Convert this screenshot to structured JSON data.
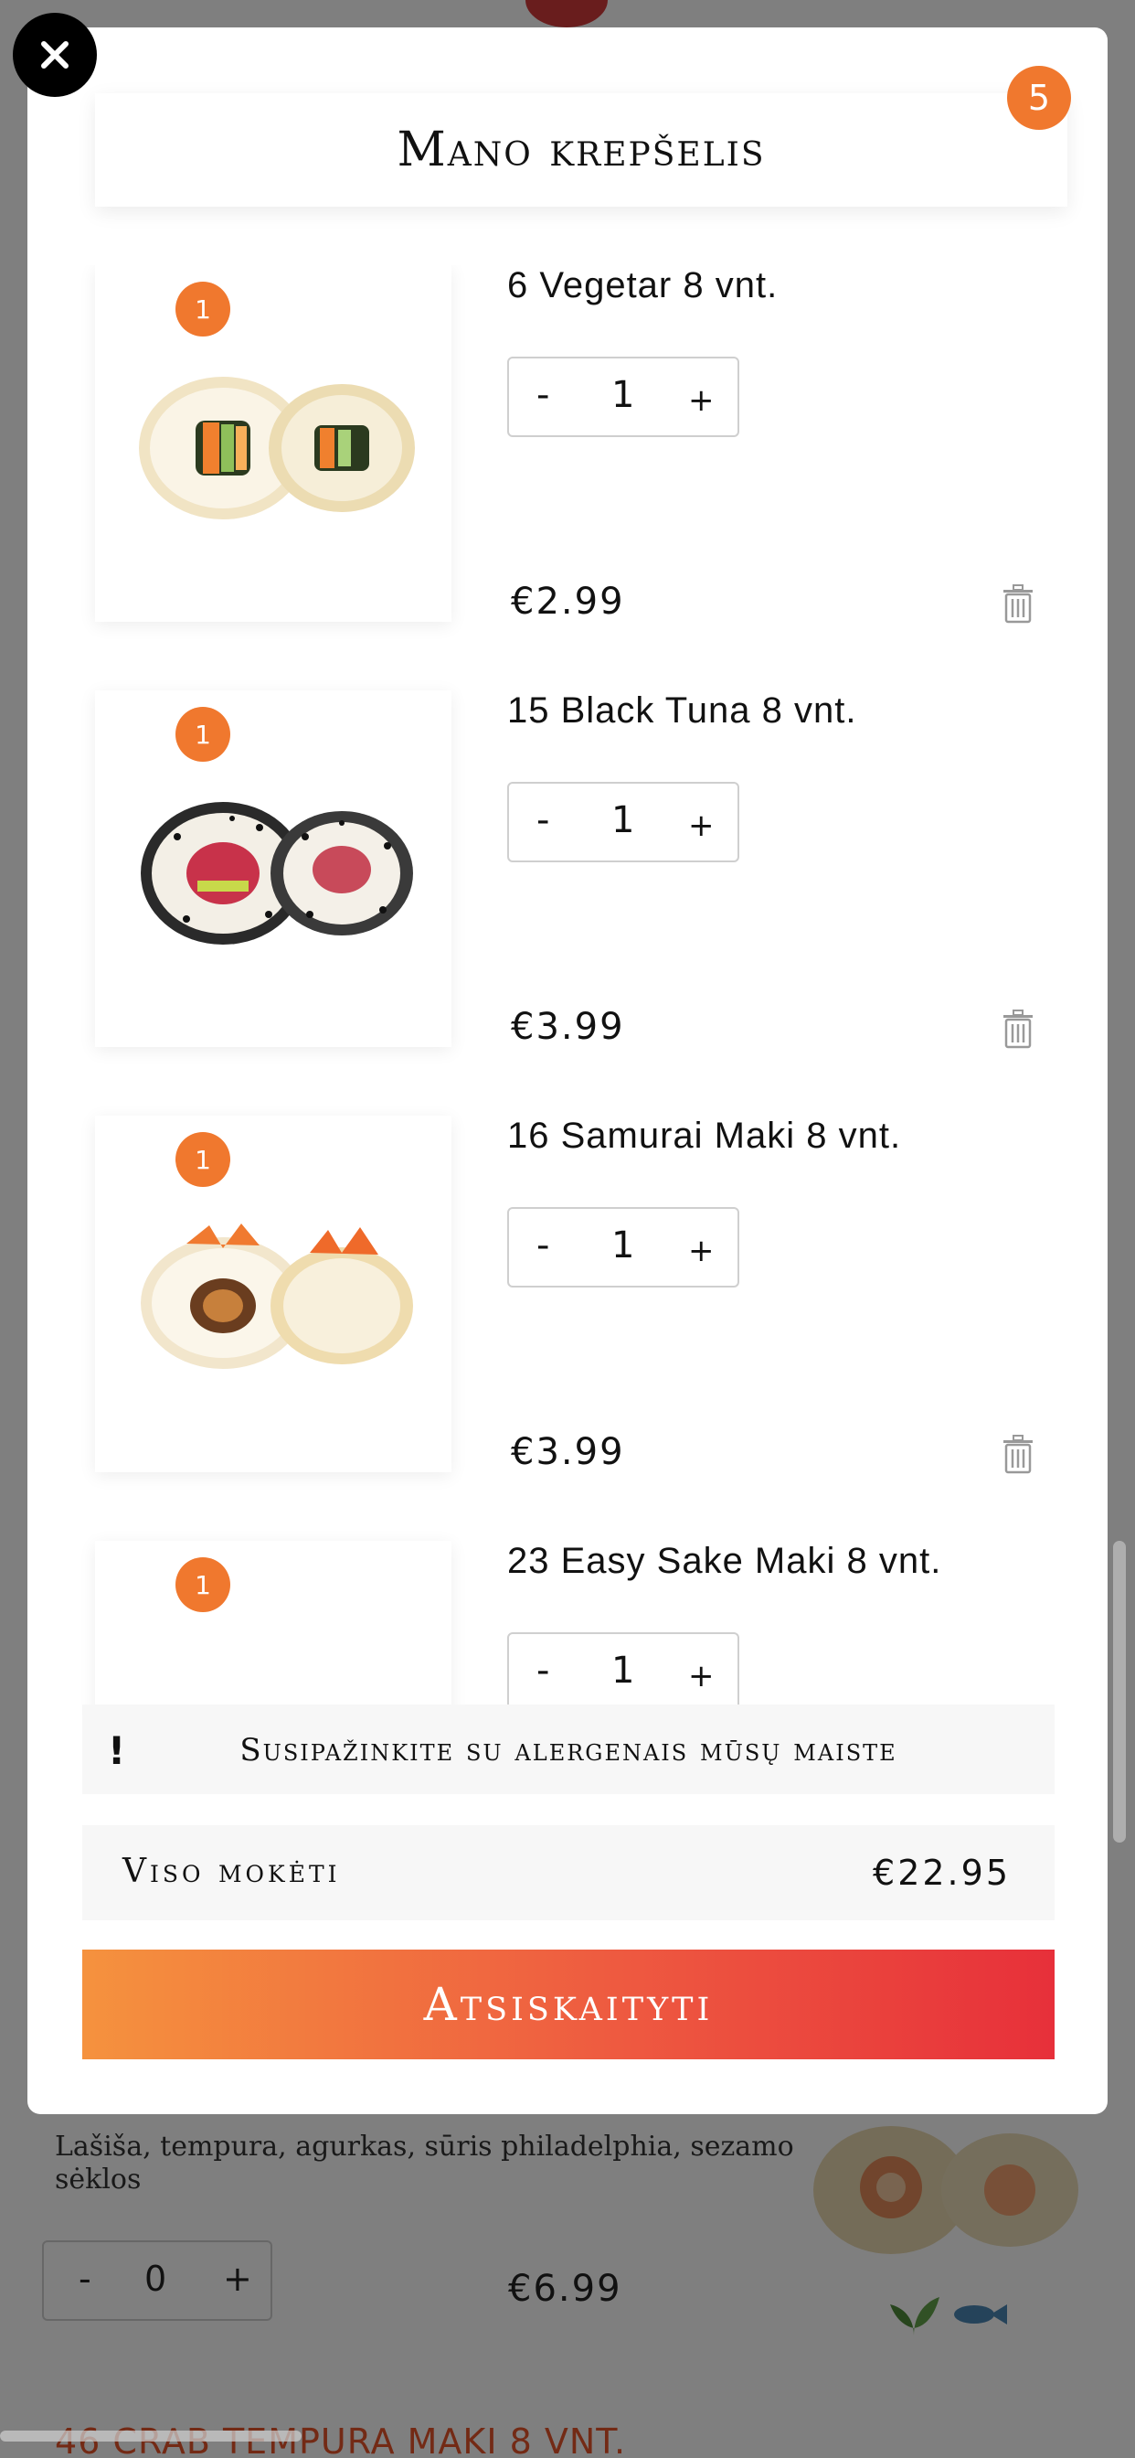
{
  "modal": {
    "title": "Mano krepšelis",
    "cart_count": "5",
    "items": [
      {
        "qty_badge": "1",
        "name": "6 Vegetar 8 vnt.",
        "minus": "-",
        "quantity": "1",
        "plus": "+",
        "price": "€2.99",
        "image": "vegetable-sushi-roll"
      },
      {
        "qty_badge": "1",
        "name": "15 Black Tuna 8 vnt.",
        "minus": "-",
        "quantity": "1",
        "plus": "+",
        "price": "€3.99",
        "image": "black-sesame-tuna-roll"
      },
      {
        "qty_badge": "1",
        "name": "16 Samurai Maki 8 vnt.",
        "minus": "-",
        "quantity": "1",
        "plus": "+",
        "price": "€3.99",
        "image": "samurai-maki-roll"
      },
      {
        "qty_badge": "1",
        "name": "23 Easy Sake Maki 8 vnt.",
        "minus": "-",
        "quantity": "1",
        "plus": "+",
        "price": "",
        "image": "easy-sake-maki-roll"
      }
    ],
    "allergen": {
      "icon": "!",
      "label": "Susipažinkite su alergenais mūsų maiste"
    },
    "total": {
      "label": "Viso mokėti",
      "amount": "€22.95"
    },
    "checkout_label": "Atsiskaityti"
  },
  "background": {
    "description": "Lašiša, tempura, agurkas, sūris philadelphia, sezamo sėklos",
    "minus": "-",
    "quantity": "0",
    "plus": "+",
    "price": "€6.99",
    "next_item_title": "46 Crab tempura maki 8 vnt."
  },
  "colors": {
    "accent": "#f0782e",
    "checkout_start": "#f5923e",
    "checkout_end": "#e7303a",
    "overlay": "rgba(0,0,0,0.5)"
  },
  "icons": {
    "close": "close-icon",
    "trash": "trash-icon",
    "allergen": "exclamation-icon",
    "leaf": "leaf-icon",
    "fish": "fish-icon"
  }
}
